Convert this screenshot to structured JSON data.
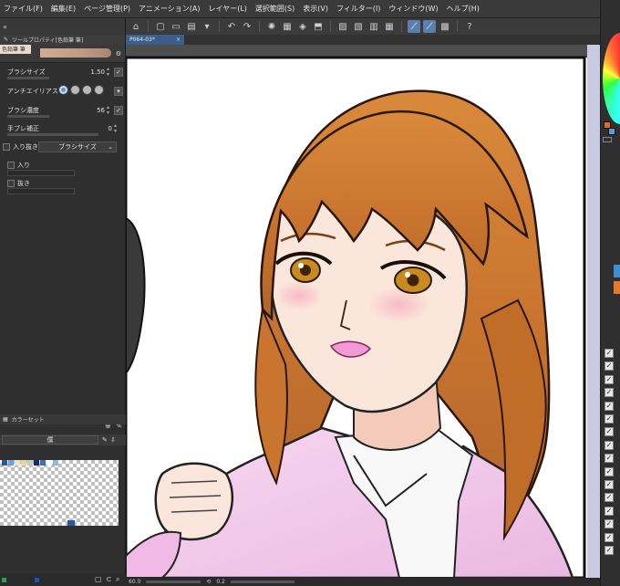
{
  "menu": [
    "ファイル(F)",
    "編集(E)",
    "ページ管理(P)",
    "アニメーション(A)",
    "レイヤー(L)",
    "選択範囲(S)",
    "表示(V)",
    "フィルター(I)",
    "ウィンドウ(W)",
    "ヘルプ(H)"
  ],
  "tool_property": {
    "panel_title": "ツールプロパティ[色鉛筆 筆]",
    "brush_chip": "色鉛筆 筆",
    "brush_size_label": "ブラシサイズ",
    "brush_size_value": "1.50",
    "antialias_label": "アンチエイリアス",
    "density_label": "ブラシ濃度",
    "density_value": "56",
    "stabilization_label": "手ブレ補正",
    "stabilization_value": "0",
    "taper_label": "入り抜き",
    "taper_dropdown": "ブラシサイズ",
    "taper_in_label": "入り",
    "taper_out_label": "抜き"
  },
  "color_set": {
    "tab_label": "カラーセット",
    "selected_set": "僕"
  },
  "document": {
    "tab_label": "P064-03*",
    "close": "×"
  },
  "status": {
    "zoom": "60.0",
    "angle": "0.2"
  },
  "colors": {
    "accent": "#3e5e8a",
    "hair": "#c9782f",
    "skin": "#fbe6dc",
    "jacket": "#f3c8ea"
  },
  "swatch_colors": [
    "#2b57a8",
    "#6fa0d8",
    "#e9e3cf",
    "#f3d58a",
    "#c8c8c8",
    "#1a2c66",
    "#3d6fb5",
    "#ffffff",
    "#8fb7e0"
  ],
  "layer_checks": 16
}
